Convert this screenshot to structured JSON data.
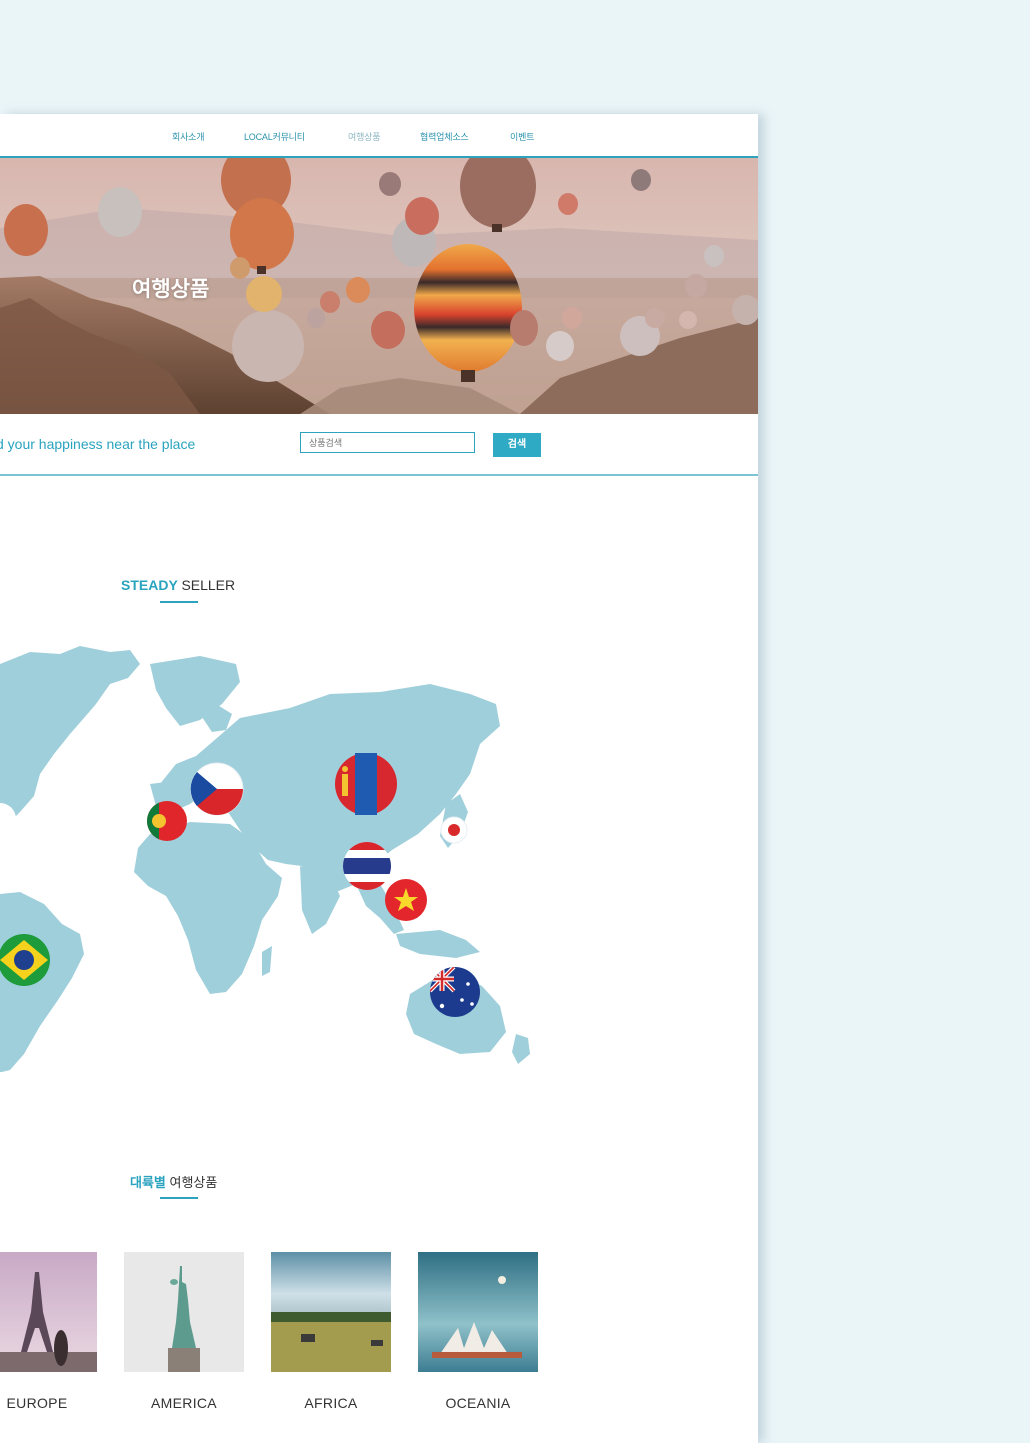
{
  "nav": {
    "items": [
      {
        "label": "회사소개",
        "muted": false
      },
      {
        "label": "LOCAL커뮤니티",
        "muted": false
      },
      {
        "label": "여행상품",
        "muted": true
      },
      {
        "label": "협력업체소스",
        "muted": false
      },
      {
        "label": "이벤트",
        "muted": false
      }
    ]
  },
  "hero": {
    "title": "여행상품"
  },
  "search": {
    "tagline": "d your happiness near the place",
    "placeholder": "상품검색",
    "button_label": "검색"
  },
  "steady_seller": {
    "highlight": "STEADY",
    "rest": "SELLER"
  },
  "map": {
    "flags": [
      "usa-flag-icon",
      "portugal-flag-icon",
      "czech-flag-icon",
      "mongolia-flag-icon",
      "japan-flag-icon",
      "thailand-flag-icon",
      "vietnam-flag-icon",
      "brazil-flag-icon",
      "australia-flag-icon"
    ]
  },
  "regions_section": {
    "highlight": "대륙별",
    "rest": "여행상품"
  },
  "regions": [
    {
      "label": "EUROPE"
    },
    {
      "label": "AMERICA"
    },
    {
      "label": "AFRICA"
    },
    {
      "label": "OCEANIA"
    }
  ],
  "colors": {
    "accent": "#2ea3bd",
    "map_land": "#9fcfdb",
    "background": "#eaf5f8"
  }
}
